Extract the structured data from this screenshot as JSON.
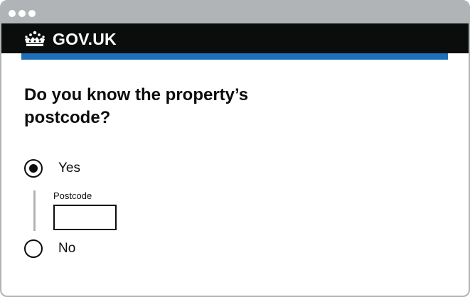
{
  "header": {
    "logo_text": "GOV.UK",
    "logo_icon": "crown-icon",
    "background_color": "#0b0c0c",
    "accent_color": "#1d70b8"
  },
  "question": {
    "title": "Do you know the property’s postcode?"
  },
  "options": {
    "yes": {
      "label": "Yes",
      "selected": true
    },
    "no": {
      "label": "No",
      "selected": false
    }
  },
  "postcode": {
    "label": "Postcode",
    "value": ""
  }
}
